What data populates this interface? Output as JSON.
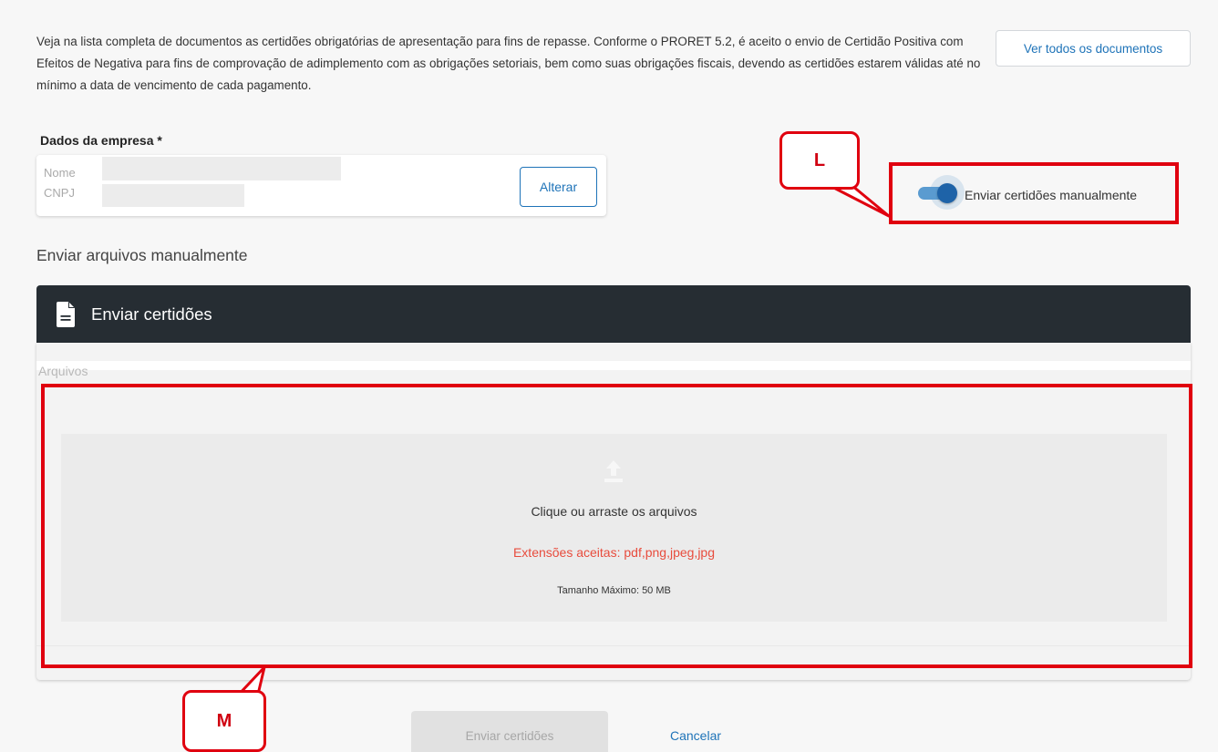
{
  "intro": {
    "text": "Veja na lista completa de documentos as certidões obrigatórias de apresentação para fins de repasse. Conforme o PRORET 5.2, é aceito o envio de Certidão Positiva com Efeitos de Negativa para fins de comprovação de adimplemento com as obrigações setoriais, bem como suas obrigações fiscais, devendo as certidões estarem válidas até no mínimo a data de vencimento de cada pagamento.",
    "view_all_label": "Ver todos os documentos"
  },
  "company": {
    "title": "Dados da empresa *",
    "name_label": "Nome",
    "cnpj_label": "CNPJ",
    "change_label": "Alterar"
  },
  "toggle": {
    "label": "Enviar certidões manualmente",
    "checked": true
  },
  "callouts": {
    "l": "L",
    "m": "M"
  },
  "section": {
    "heading": "Enviar arquivos manualmente",
    "panel_title": "Enviar certidões",
    "files_label": "Arquivos"
  },
  "dropzone": {
    "main_text": "Clique ou arraste os arquivos",
    "extensions_text": "Extensões aceitas: pdf,png,jpeg,jpg",
    "max_size_text": "Tamanho Máximo: 50 MB"
  },
  "actions": {
    "submit_label": "Enviar certidões",
    "cancel_label": "Cancelar"
  },
  "colors": {
    "accent": "#1e73b8",
    "annotation_red": "#e0000f",
    "header_dark": "#262d33",
    "extension_red": "#e84c3d"
  }
}
